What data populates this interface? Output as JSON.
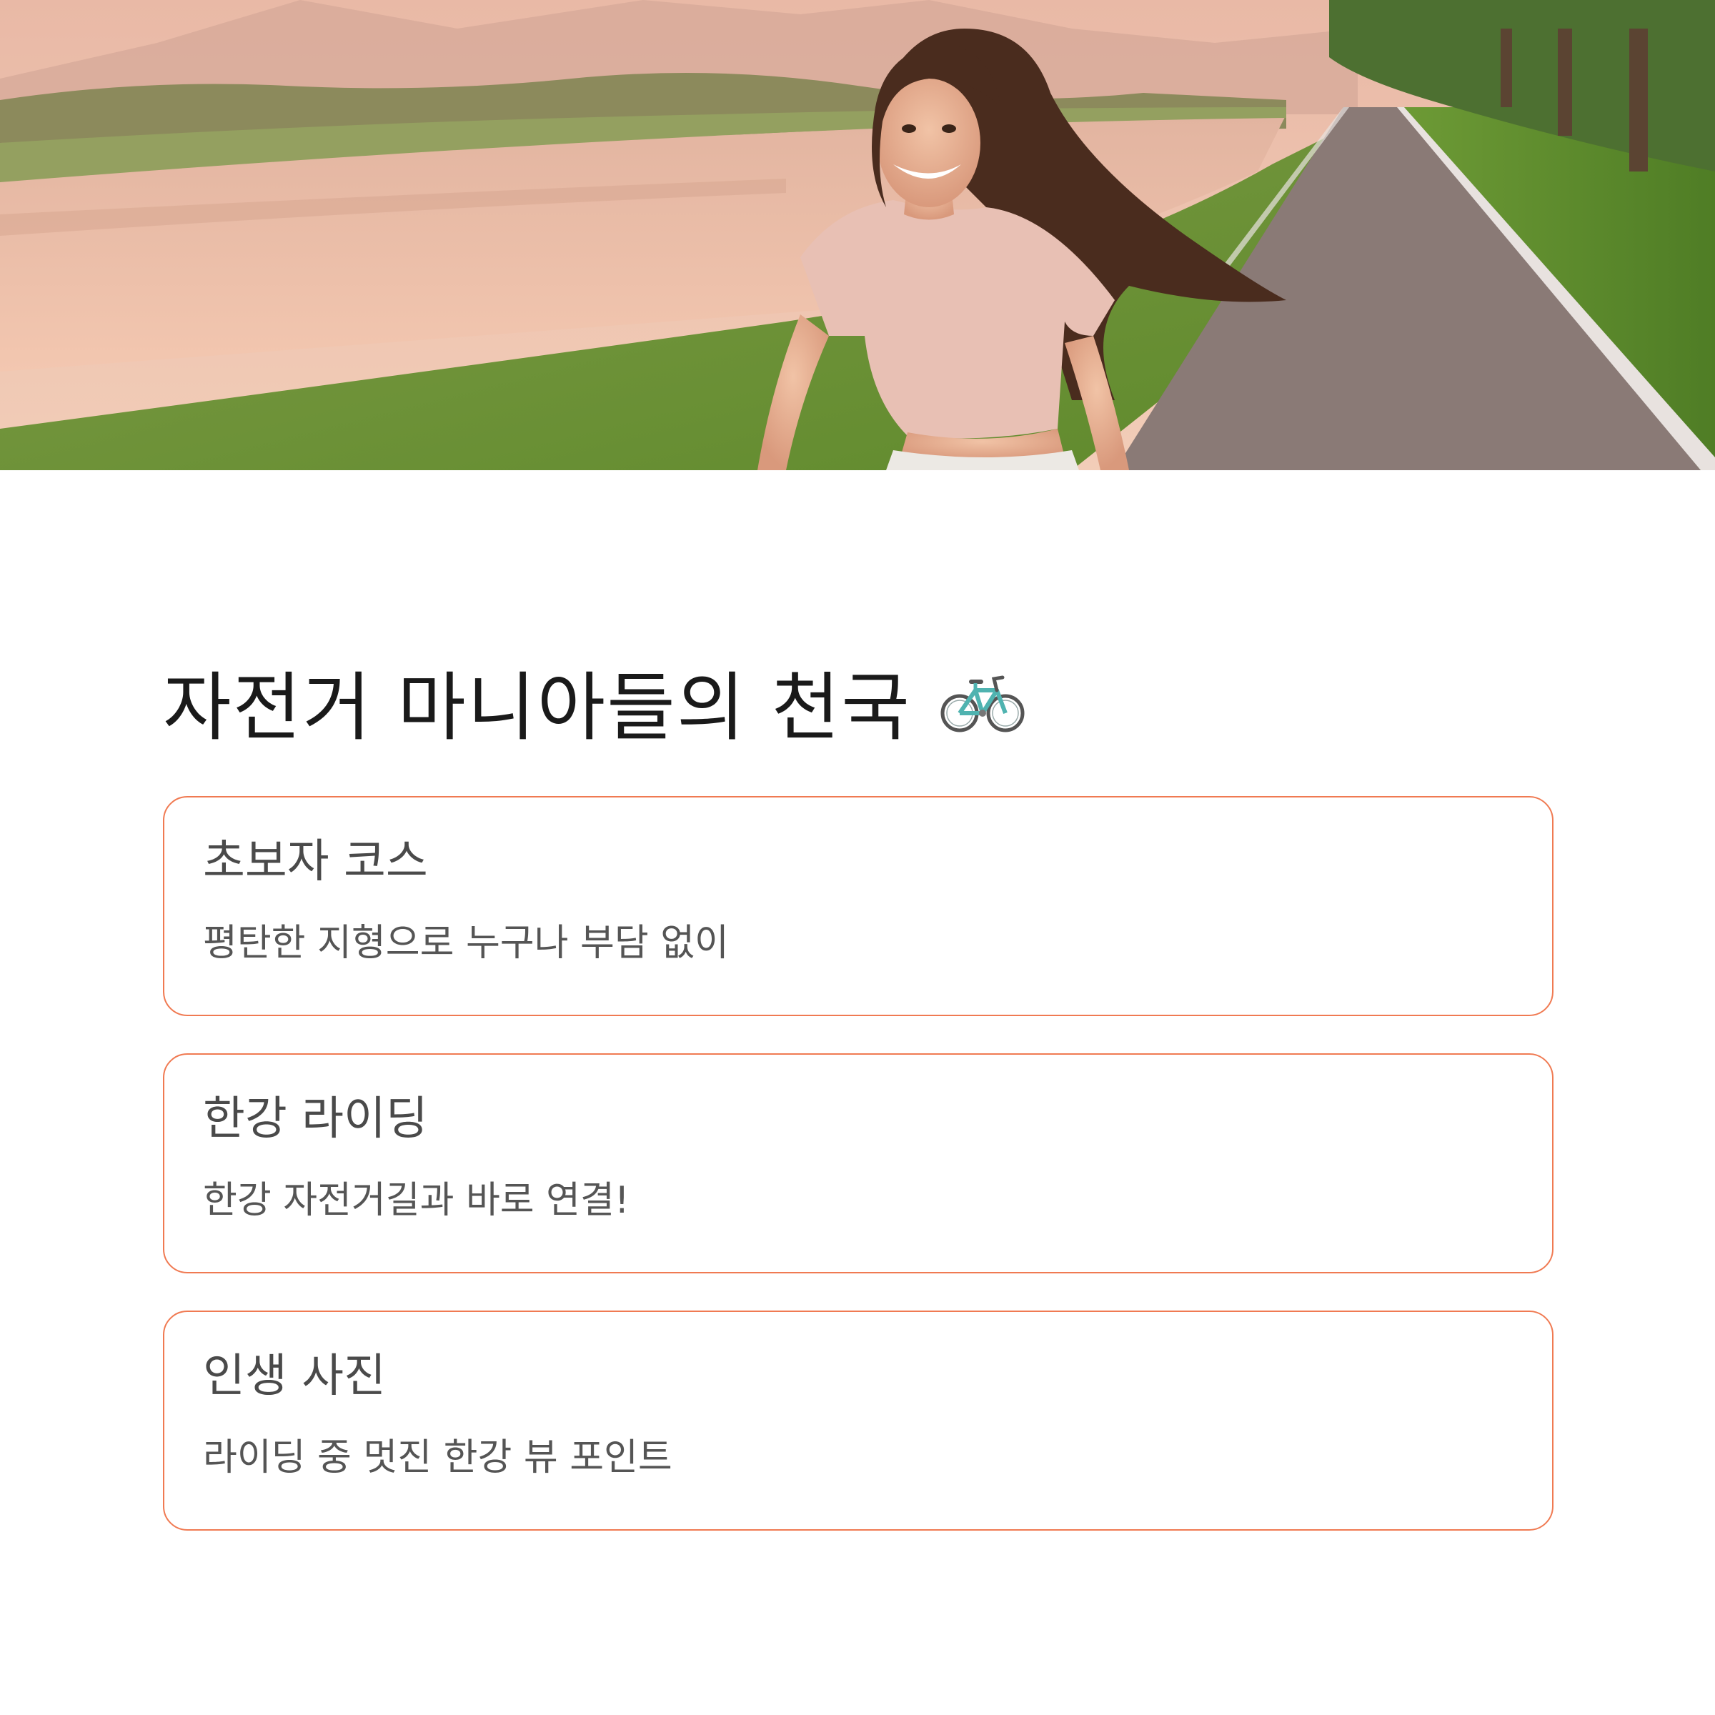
{
  "hero": {
    "image": "woman-riding-bicycle-along-river-path"
  },
  "main": {
    "title": "자전거 마니아들의 천국",
    "title_icon": "bicycle-icon"
  },
  "colors": {
    "card_border": "#f07a52",
    "title_text": "#1a1a1a",
    "card_text": "#4a4a4a"
  },
  "cards": [
    {
      "title": "초보자 코스",
      "desc": "평탄한 지형으로 누구나 부담 없이"
    },
    {
      "title": "한강 라이딩",
      "desc": "한강 자전거길과 바로 연결!"
    },
    {
      "title": "인생 사진",
      "desc": "라이딩 중 멋진 한강 뷰 포인트"
    }
  ]
}
